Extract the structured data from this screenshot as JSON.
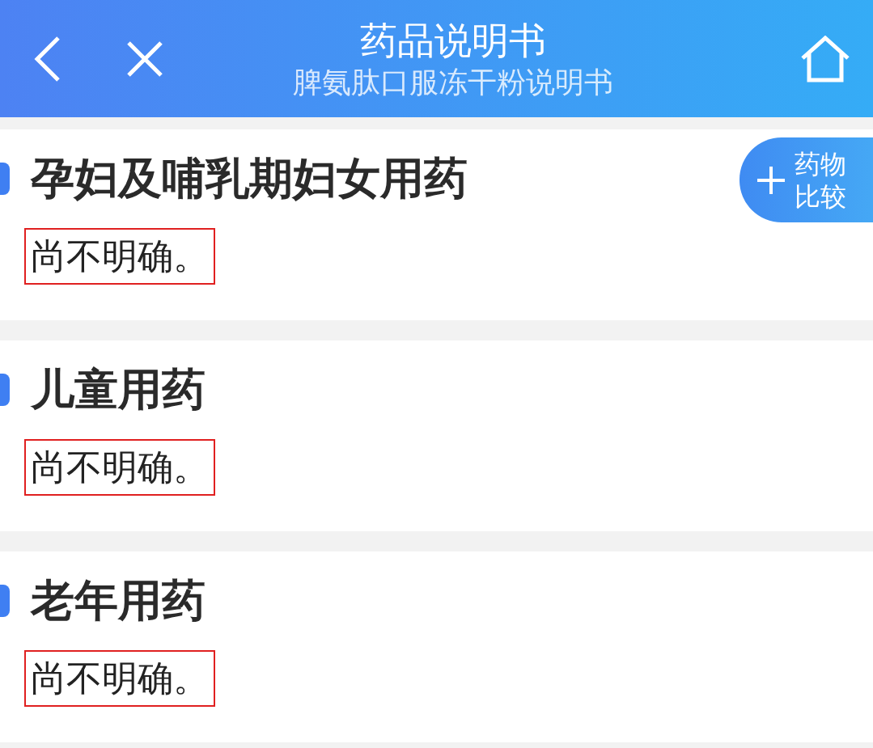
{
  "header": {
    "title": "药品说明书",
    "subtitle": "脾氨肽口服冻干粉说明书"
  },
  "compare_button": {
    "label_line_1": "药物",
    "label_line_2": "比较"
  },
  "sections": [
    {
      "heading": "孕妇及哺乳期妇女用药",
      "body": "尚不明确。",
      "highlighted": true
    },
    {
      "heading": "儿童用药",
      "body": "尚不明确。",
      "highlighted": true
    },
    {
      "heading": "老年用药",
      "body": "尚不明确。",
      "highlighted": true
    }
  ]
}
